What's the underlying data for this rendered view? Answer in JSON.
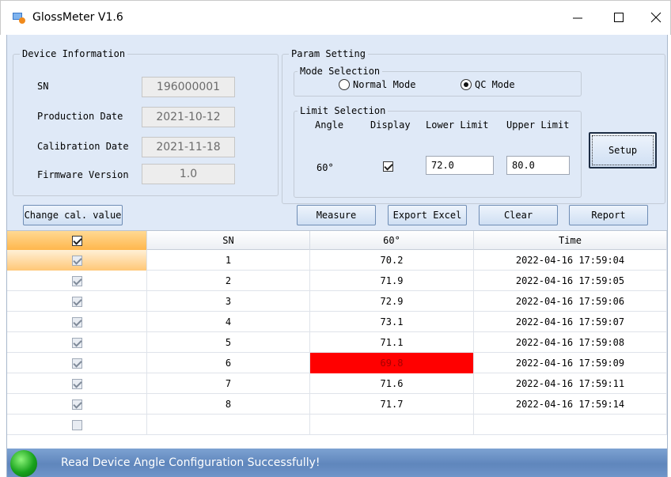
{
  "window": {
    "title": "GlossMeter V1.6"
  },
  "device_info": {
    "title": "Device Information",
    "fields": [
      {
        "label": "SN",
        "value": "196000001"
      },
      {
        "label": "Production Date",
        "value": "2021-10-12"
      },
      {
        "label": "Calibration Date",
        "value": "2021-11-18"
      },
      {
        "label": "Firmware  Version",
        "value": "1.0"
      }
    ]
  },
  "param_setting": {
    "title": "Param Setting",
    "mode_selection": {
      "title": "Mode Selection",
      "options": [
        "Normal Mode",
        "QC Mode"
      ],
      "selected": "QC Mode"
    },
    "limit_selection": {
      "title": "Limit Selection",
      "headers": {
        "angle": "Angle",
        "display": "Display",
        "lower": "Lower Limit",
        "upper": "Upper Limit"
      },
      "row": {
        "angle": "60°",
        "display_checked": true,
        "lower": "72.0",
        "upper": "80.0"
      }
    },
    "setup_label": "Setup"
  },
  "toolbar": {
    "change_cal_label": "Change cal. value",
    "measure_label": "Measure",
    "export_label": "Export Excel",
    "clear_label": "Clear",
    "report_label": "Report"
  },
  "table": {
    "columns": [
      "SN",
      "60°",
      "Time"
    ],
    "rows": [
      {
        "sn": "1",
        "value": "70.2",
        "time": "2022-04-16 17:59:04",
        "checked": true,
        "out_of_range": false
      },
      {
        "sn": "2",
        "value": "71.9",
        "time": "2022-04-16 17:59:05",
        "checked": true,
        "out_of_range": false
      },
      {
        "sn": "3",
        "value": "72.9",
        "time": "2022-04-16 17:59:06",
        "checked": true,
        "out_of_range": false
      },
      {
        "sn": "4",
        "value": "73.1",
        "time": "2022-04-16 17:59:07",
        "checked": true,
        "out_of_range": false
      },
      {
        "sn": "5",
        "value": "71.1",
        "time": "2022-04-16 17:59:08",
        "checked": true,
        "out_of_range": false
      },
      {
        "sn": "6",
        "value": "69.8",
        "time": "2022-04-16 17:59:09",
        "checked": true,
        "out_of_range": true
      },
      {
        "sn": "7",
        "value": "71.6",
        "time": "2022-04-16 17:59:11",
        "checked": true,
        "out_of_range": false
      },
      {
        "sn": "8",
        "value": "71.7",
        "time": "2022-04-16 17:59:14",
        "checked": true,
        "out_of_range": false
      },
      {
        "sn": "",
        "value": "",
        "time": "",
        "checked": false,
        "out_of_range": false
      }
    ]
  },
  "status": {
    "message": "Read Device Angle Configuration Successfully!"
  },
  "colors": {
    "out_of_range": "#ff0000",
    "panel": "#dfe9f7",
    "status_bar": "#6f95c9",
    "led": "#18a21c"
  }
}
